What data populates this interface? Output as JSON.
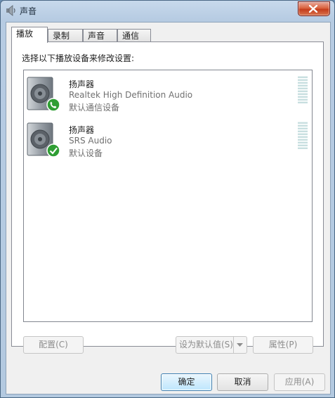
{
  "window": {
    "title": "声音",
    "title_icon": "speaker-icon",
    "close_icon": "close-icon",
    "accent_close": "#c43c1b"
  },
  "tabs": [
    {
      "label": "播放",
      "active": true
    },
    {
      "label": "录制",
      "active": false
    },
    {
      "label": "声音",
      "active": false
    },
    {
      "label": "通信",
      "active": false
    }
  ],
  "playback": {
    "instruction": "选择以下播放设备来修改设置:",
    "devices": [
      {
        "name": "扬声器",
        "description": "Realtek High Definition Audio",
        "status": "默认通信设备",
        "icon": "speaker-icon",
        "badge": "phone-badge-icon",
        "badge_color": "#2f9e34"
      },
      {
        "name": "扬声器",
        "description": "SRS Audio",
        "status": "默认设备",
        "icon": "speaker-icon",
        "badge": "checkmark-badge-icon",
        "badge_color": "#2f9e34"
      }
    ],
    "configure_button": "配置(C)",
    "set_default_button": "设为默认值(S)",
    "properties_button": "属性(P)"
  },
  "footer": {
    "ok_button": "确定",
    "cancel_button": "取消",
    "apply_button": "应用(A)"
  }
}
